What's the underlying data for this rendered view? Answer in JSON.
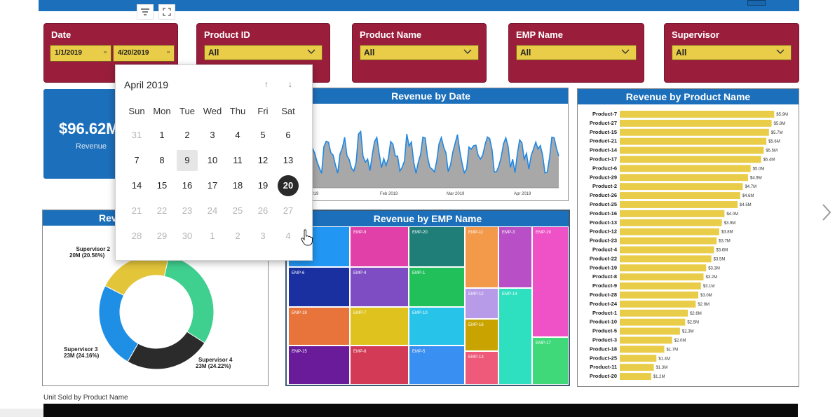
{
  "slicers": {
    "date": {
      "title": "Date",
      "start": "1/1/2019",
      "end": "4/20/2019"
    },
    "product_id": {
      "title": "Product ID",
      "value": "All"
    },
    "product_name": {
      "title": "Product Name",
      "value": "All"
    },
    "emp_name": {
      "title": "EMP Name",
      "value": "All"
    },
    "supervisor": {
      "title": "Supervisor",
      "value": "All"
    }
  },
  "kpi": {
    "value": "$96.62M",
    "label": "Revenue"
  },
  "calendar": {
    "month": "April 2019",
    "weekdays": [
      "Sun",
      "Mon",
      "Tue",
      "Wed",
      "Thu",
      "Fri",
      "Sat"
    ],
    "weeks": [
      [
        "31",
        "1",
        "2",
        "3",
        "4",
        "5",
        "6"
      ],
      [
        "7",
        "8",
        "9",
        "10",
        "11",
        "12",
        "13"
      ],
      [
        "14",
        "15",
        "16",
        "17",
        "18",
        "19",
        "20"
      ],
      [
        "21",
        "22",
        "23",
        "24",
        "25",
        "26",
        "27"
      ],
      [
        "28",
        "29",
        "30",
        "1",
        "2",
        "3",
        "4"
      ]
    ],
    "selected_day": "20",
    "hovered_day": "9"
  },
  "donut": {
    "title": "Rev",
    "labels": {
      "sup2": [
        "Supervisor 2",
        "20M (20.56%)"
      ],
      "sup3": [
        "Supervisor 3",
        "23M (24.16%)"
      ],
      "sup4": [
        "Supervisor 4",
        "23M (24.22%)"
      ]
    },
    "colors": [
      "#3fcf8e",
      "#2b2b2b",
      "#1e8fe4",
      "#e3c53a"
    ]
  },
  "line_chart": {
    "title": "Revenue by Date",
    "x_ticks": [
      "2019",
      "Feb 2019",
      "Mar 2019",
      "Apr 2019"
    ]
  },
  "treemap": {
    "title": "Revenue by EMP Name",
    "columns": [
      [
        {
          "label": "",
          "color": "#2196f3"
        },
        {
          "label": "EMP-6",
          "color": "#1a2fa0"
        },
        {
          "label": "EMP-18",
          "color": "#e8743b"
        },
        {
          "label": "EMP-15",
          "color": "#6a1b9a"
        }
      ],
      [
        {
          "label": "EMP-9",
          "color": "#e040a8"
        },
        {
          "label": "EMP-4",
          "color": "#7e4dc4"
        },
        {
          "label": "EMP-7",
          "color": "#e0c21f"
        },
        {
          "label": "EMP-8",
          "color": "#d23a56"
        }
      ],
      [
        {
          "label": "EMP-20",
          "color": "#1f7f78"
        },
        {
          "label": "EMP-1",
          "color": "#22c05b"
        },
        {
          "label": "EMP-10",
          "color": "#27c3e8"
        },
        {
          "label": "EMP-5",
          "color": "#3a8ff2"
        }
      ],
      [
        {
          "label": "EMP-11",
          "color": "#f39a4a"
        },
        {
          "label": "EMP-12",
          "color": "#b79be8"
        },
        {
          "label": "EMP-16",
          "color": "#c9a400"
        },
        {
          "label": "EMP-13",
          "color": "#ef5a7a"
        }
      ],
      [
        {
          "label": "EMP-3",
          "color": "#b84fc6"
        },
        {
          "label": "EMP-14",
          "color": "#2fe0c0"
        }
      ],
      [
        {
          "label": "EMP-19",
          "color": "#ef52c6"
        },
        {
          "label": "EMP-17",
          "color": "#3fd97a"
        }
      ]
    ]
  },
  "chart_data": {
    "type": "bar",
    "title": "Revenue by Product Name",
    "categories": [
      "Product-7",
      "Product-27",
      "Product-15",
      "Product-21",
      "Product-14",
      "Product-17",
      "Product-6",
      "Product-29",
      "Product-2",
      "Product-26",
      "Product-25",
      "Product-16",
      "Product-13",
      "Product-12",
      "Product-23",
      "Product-4",
      "Product-22",
      "Product-19",
      "Product-8",
      "Product-9",
      "Product-28",
      "Product-24",
      "Product-1",
      "Product-10",
      "Product-5",
      "Product-3",
      "Product-18",
      "Product-25",
      "Product-11",
      "Product-20"
    ],
    "values": [
      5.9,
      5.8,
      5.7,
      5.6,
      5.5,
      5.4,
      5.0,
      4.9,
      4.7,
      4.6,
      4.5,
      4.0,
      3.9,
      3.8,
      3.7,
      3.6,
      3.5,
      3.3,
      3.2,
      3.1,
      3.0,
      2.9,
      2.6,
      2.5,
      2.3,
      2.0,
      1.7,
      1.4,
      1.3,
      1.2
    ],
    "data_labels": [
      "$5.9M",
      "$5.8M",
      "$5.7M",
      "$5.6M",
      "$5.5M",
      "$5.4M",
      "$5.0M",
      "$4.9M",
      "$4.7M",
      "$4.6M",
      "$4.5M",
      "$4.0M",
      "$3.9M",
      "$3.8M",
      "$3.7M",
      "$3.6M",
      "$3.5M",
      "$3.3M",
      "$3.2M",
      "$3.1M",
      "$3.0M",
      "$2.9M",
      "$2.6M",
      "$2.5M",
      "$2.3M",
      "$2.0M",
      "$1.7M",
      "$1.4M",
      "$1.3M",
      "$1.2M"
    ],
    "ylim": [
      0,
      6.0
    ],
    "bar_color": "#e9cc47"
  },
  "bottom": {
    "label": "Unit Sold by Product Name"
  }
}
